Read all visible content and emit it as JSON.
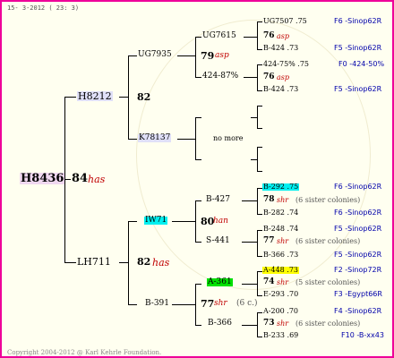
{
  "header_date": "15- 3-2012 ( 23: 3)",
  "footer_copyright": "Copyright 2004-2012 @ Karl Kehrle Foundation.",
  "colors": {
    "border": "#ee0099",
    "pink": "#f0d8f0",
    "lavender": "#e0e0f8",
    "cyan": "#00f0f0",
    "yellow": "#ffff00",
    "green": "#00e000",
    "red": "#c00000",
    "blue": "#0000aa"
  },
  "root": {
    "id": "H8436",
    "num": "84",
    "race": "has"
  },
  "gen1": {
    "sire": {
      "id": "H8212",
      "num": "82",
      "race": ""
    },
    "dam": {
      "id": "LH711",
      "num": "82",
      "race": "has"
    }
  },
  "gen2": {
    "s1": {
      "id": "UG7935",
      "num": "79",
      "race": "asp"
    },
    "s2": {
      "id": "K78137",
      "note": "no more"
    },
    "d1": {
      "id": "IW71",
      "num": "80",
      "race": "han"
    },
    "d2": {
      "id": "B-391",
      "num": "77",
      "race": "shr",
      "extra": "(6 c.)"
    }
  },
  "gen3": {
    "a": "UG7615",
    "b": "424-87%",
    "c": "B-427",
    "d": "S-441",
    "e": "A-361",
    "f": "B-366"
  },
  "gen4": [
    {
      "top": "UG7507 .75",
      "num": "76",
      "race": "asp",
      "bottom": "B-424 .73",
      "right_top": "F6 -Sinop62R",
      "right_bottom": "F5 -Sinop62R"
    },
    {
      "top": "424-75% .75",
      "num": "76",
      "race": "asp",
      "bottom": "B-424 .73",
      "right_top": "F0 -424-50%",
      "right_bottom": "F5 -Sinop62R"
    },
    {
      "top": "B-292 .75",
      "num": "78",
      "race": "shr",
      "extra": "(6 sister colonies)",
      "bottom": "B-282 .74",
      "right_top": "F6 -Sinop62R",
      "right_bottom": "F6 -Sinop62R"
    },
    {
      "top": "B-248 .74",
      "num": "77",
      "race": "shr",
      "extra": "(6 sister colonies)",
      "bottom": "B-366 .73",
      "right_top": "F5 -Sinop62R",
      "right_bottom": "F5 -Sinop62R"
    },
    {
      "top": "A-448 .73",
      "num": "74",
      "race": "shr",
      "extra": "(5 sister colonies)",
      "bottom": "E-293 .70",
      "right_top": "F2 -Sinop72R",
      "right_bottom": "F3 -Egypt66R"
    },
    {
      "top": "A-200 .70",
      "num": "73",
      "race": "shr",
      "extra": "(6 sister colonies)",
      "bottom": "B-233 .69",
      "right_top": "F4 -Sinop62R",
      "right_bottom": "F10 -B-xx43"
    }
  ]
}
